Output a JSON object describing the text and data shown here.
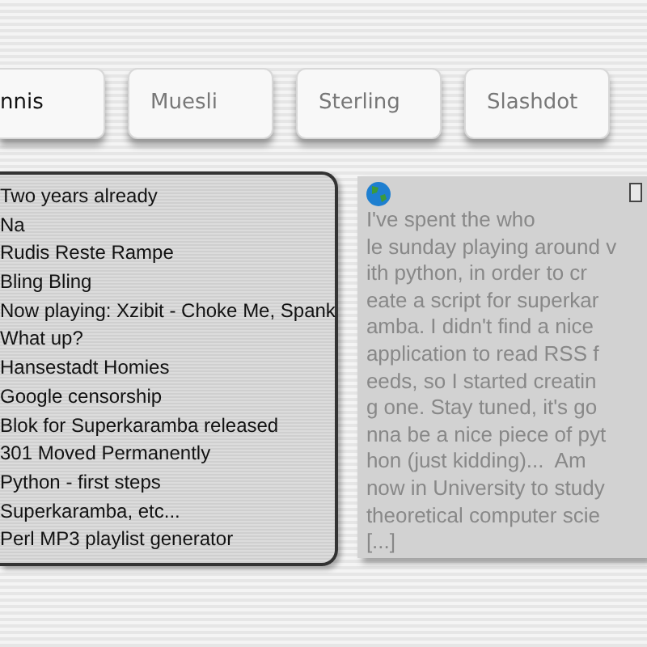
{
  "tabs": [
    {
      "label": "nnis",
      "selected": true
    },
    {
      "label": "Muesli",
      "selected": false
    },
    {
      "label": "Sterling",
      "selected": false
    },
    {
      "label": "Slashdot",
      "selected": false
    }
  ],
  "headlines": [
    "Two years already",
    "Na",
    "Rudis Reste Rampe",
    "Bling Bling",
    "Now playing: Xzibit - Choke Me, Spank",
    "What up?",
    "Hansestadt Homies",
    "Google censorship",
    "Blok for Superkaramba released",
    "301 Moved Permanently",
    "Python - first steps",
    "Superkaramba, etc...",
    "Perl MP3 playlist generator"
  ],
  "preview": {
    "lines": [
      "I've spent the who",
      "le sunday playing around v",
      "ith python, in order to cr",
      "eate a script for superkar",
      "amba. I didn't find a nice",
      "application to read RSS f",
      "eeds, so I started creatin",
      "g one. Stay tuned, it's go",
      "nna be a nice piece of pyt",
      "hon (just kidding)...  Am",
      "now in University to study",
      "theoretical computer scie",
      "[...]"
    ]
  }
}
